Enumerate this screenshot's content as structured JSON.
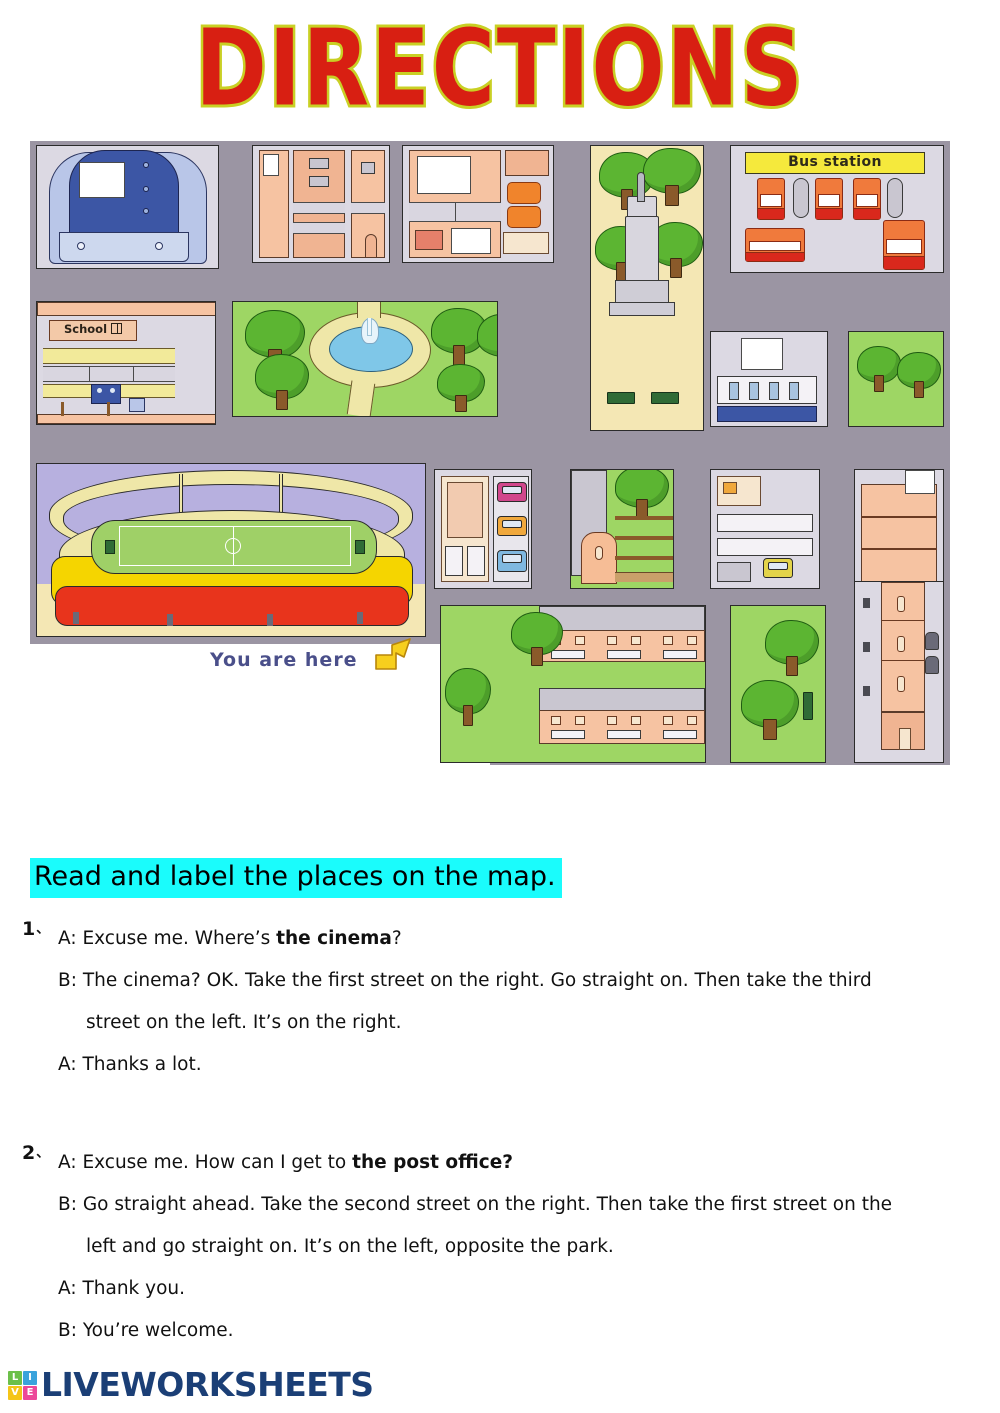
{
  "page": {
    "title": "DIRECTIONS",
    "title_fill_color": "#d81f12",
    "title_outline_color": "#c9d024"
  },
  "map": {
    "name": "town-map",
    "labels": {
      "bus_station": "Bus station",
      "school": "School",
      "you_are_here": "You are here"
    },
    "colors": {
      "road": "#9b95a3",
      "grass": "#9ed664",
      "sand": "#f4e7b4",
      "building_peach": "#f6c3a2",
      "bus_sign_yellow": "#f5e93c",
      "stadium_red": "#e8341c",
      "stadium_yellow": "#f5d500",
      "pitch_green": "#9fd067",
      "water_blue": "#7fc7e8",
      "you_are_here_text": "#4a4f8a",
      "arrow_yellow": "#f7cf1e"
    }
  },
  "instruction": {
    "text": "Read and label the places on the map.",
    "highlight_color": "#1afcfc"
  },
  "exercises": [
    {
      "number": "1",
      "tick": "、",
      "lines": [
        {
          "speaker": "A:",
          "pre": " Excuse me. Where’s ",
          "bold": "the cinema",
          "post": "?",
          "indent": false
        },
        {
          "speaker": "B:",
          "pre": " The cinema? OK. Take the first street on the right. Go straight on. Then take the third",
          "bold": "",
          "post": "",
          "indent": false
        },
        {
          "speaker": "",
          "pre": "street on the left. It’s on the right.",
          "bold": "",
          "post": "",
          "indent": true
        },
        {
          "speaker": "A:",
          "pre": " Thanks a lot.",
          "bold": "",
          "post": "",
          "indent": false
        }
      ]
    },
    {
      "number": "2",
      "tick": "、",
      "lines": [
        {
          "speaker": "A:",
          "pre": " Excuse me. How can I get to ",
          "bold": "the post office?",
          "post": "",
          "indent": false
        },
        {
          "speaker": "B:",
          "pre": " Go straight ahead. Take the second street on the right. Then take the first street on the",
          "bold": "",
          "post": "",
          "indent": false
        },
        {
          "speaker": "",
          "pre": "left and go straight on. It’s on the left, opposite the park.",
          "bold": "",
          "post": "",
          "indent": true
        },
        {
          "speaker": "A:",
          "pre": " Thank you.",
          "bold": "",
          "post": "",
          "indent": false
        },
        {
          "speaker": "B:",
          "pre": " You’re welcome.",
          "bold": "",
          "post": "",
          "indent": false
        }
      ]
    }
  ],
  "footer": {
    "tiles": [
      "L",
      "I",
      "V",
      "E"
    ],
    "brand": "LIVEWORKSHEETS",
    "brand_color": "#1b3f76"
  }
}
